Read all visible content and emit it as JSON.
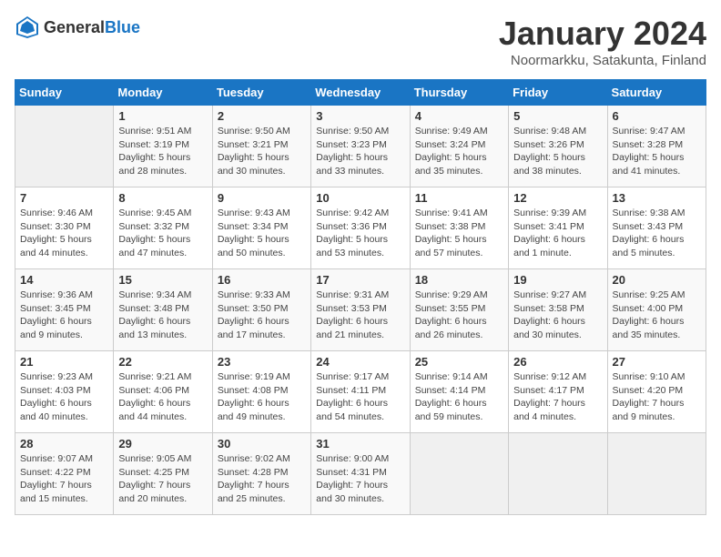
{
  "logo": {
    "text_general": "General",
    "text_blue": "Blue"
  },
  "title": "January 2024",
  "location": "Noormarkku, Satakunta, Finland",
  "days_of_week": [
    "Sunday",
    "Monday",
    "Tuesday",
    "Wednesday",
    "Thursday",
    "Friday",
    "Saturday"
  ],
  "weeks": [
    [
      {
        "day": "",
        "sunrise": "",
        "sunset": "",
        "daylight": ""
      },
      {
        "day": "1",
        "sunrise": "Sunrise: 9:51 AM",
        "sunset": "Sunset: 3:19 PM",
        "daylight": "Daylight: 5 hours and 28 minutes."
      },
      {
        "day": "2",
        "sunrise": "Sunrise: 9:50 AM",
        "sunset": "Sunset: 3:21 PM",
        "daylight": "Daylight: 5 hours and 30 minutes."
      },
      {
        "day": "3",
        "sunrise": "Sunrise: 9:50 AM",
        "sunset": "Sunset: 3:23 PM",
        "daylight": "Daylight: 5 hours and 33 minutes."
      },
      {
        "day": "4",
        "sunrise": "Sunrise: 9:49 AM",
        "sunset": "Sunset: 3:24 PM",
        "daylight": "Daylight: 5 hours and 35 minutes."
      },
      {
        "day": "5",
        "sunrise": "Sunrise: 9:48 AM",
        "sunset": "Sunset: 3:26 PM",
        "daylight": "Daylight: 5 hours and 38 minutes."
      },
      {
        "day": "6",
        "sunrise": "Sunrise: 9:47 AM",
        "sunset": "Sunset: 3:28 PM",
        "daylight": "Daylight: 5 hours and 41 minutes."
      }
    ],
    [
      {
        "day": "7",
        "sunrise": "Sunrise: 9:46 AM",
        "sunset": "Sunset: 3:30 PM",
        "daylight": "Daylight: 5 hours and 44 minutes."
      },
      {
        "day": "8",
        "sunrise": "Sunrise: 9:45 AM",
        "sunset": "Sunset: 3:32 PM",
        "daylight": "Daylight: 5 hours and 47 minutes."
      },
      {
        "day": "9",
        "sunrise": "Sunrise: 9:43 AM",
        "sunset": "Sunset: 3:34 PM",
        "daylight": "Daylight: 5 hours and 50 minutes."
      },
      {
        "day": "10",
        "sunrise": "Sunrise: 9:42 AM",
        "sunset": "Sunset: 3:36 PM",
        "daylight": "Daylight: 5 hours and 53 minutes."
      },
      {
        "day": "11",
        "sunrise": "Sunrise: 9:41 AM",
        "sunset": "Sunset: 3:38 PM",
        "daylight": "Daylight: 5 hours and 57 minutes."
      },
      {
        "day": "12",
        "sunrise": "Sunrise: 9:39 AM",
        "sunset": "Sunset: 3:41 PM",
        "daylight": "Daylight: 6 hours and 1 minute."
      },
      {
        "day": "13",
        "sunrise": "Sunrise: 9:38 AM",
        "sunset": "Sunset: 3:43 PM",
        "daylight": "Daylight: 6 hours and 5 minutes."
      }
    ],
    [
      {
        "day": "14",
        "sunrise": "Sunrise: 9:36 AM",
        "sunset": "Sunset: 3:45 PM",
        "daylight": "Daylight: 6 hours and 9 minutes."
      },
      {
        "day": "15",
        "sunrise": "Sunrise: 9:34 AM",
        "sunset": "Sunset: 3:48 PM",
        "daylight": "Daylight: 6 hours and 13 minutes."
      },
      {
        "day": "16",
        "sunrise": "Sunrise: 9:33 AM",
        "sunset": "Sunset: 3:50 PM",
        "daylight": "Daylight: 6 hours and 17 minutes."
      },
      {
        "day": "17",
        "sunrise": "Sunrise: 9:31 AM",
        "sunset": "Sunset: 3:53 PM",
        "daylight": "Daylight: 6 hours and 21 minutes."
      },
      {
        "day": "18",
        "sunrise": "Sunrise: 9:29 AM",
        "sunset": "Sunset: 3:55 PM",
        "daylight": "Daylight: 6 hours and 26 minutes."
      },
      {
        "day": "19",
        "sunrise": "Sunrise: 9:27 AM",
        "sunset": "Sunset: 3:58 PM",
        "daylight": "Daylight: 6 hours and 30 minutes."
      },
      {
        "day": "20",
        "sunrise": "Sunrise: 9:25 AM",
        "sunset": "Sunset: 4:00 PM",
        "daylight": "Daylight: 6 hours and 35 minutes."
      }
    ],
    [
      {
        "day": "21",
        "sunrise": "Sunrise: 9:23 AM",
        "sunset": "Sunset: 4:03 PM",
        "daylight": "Daylight: 6 hours and 40 minutes."
      },
      {
        "day": "22",
        "sunrise": "Sunrise: 9:21 AM",
        "sunset": "Sunset: 4:06 PM",
        "daylight": "Daylight: 6 hours and 44 minutes."
      },
      {
        "day": "23",
        "sunrise": "Sunrise: 9:19 AM",
        "sunset": "Sunset: 4:08 PM",
        "daylight": "Daylight: 6 hours and 49 minutes."
      },
      {
        "day": "24",
        "sunrise": "Sunrise: 9:17 AM",
        "sunset": "Sunset: 4:11 PM",
        "daylight": "Daylight: 6 hours and 54 minutes."
      },
      {
        "day": "25",
        "sunrise": "Sunrise: 9:14 AM",
        "sunset": "Sunset: 4:14 PM",
        "daylight": "Daylight: 6 hours and 59 minutes."
      },
      {
        "day": "26",
        "sunrise": "Sunrise: 9:12 AM",
        "sunset": "Sunset: 4:17 PM",
        "daylight": "Daylight: 7 hours and 4 minutes."
      },
      {
        "day": "27",
        "sunrise": "Sunrise: 9:10 AM",
        "sunset": "Sunset: 4:20 PM",
        "daylight": "Daylight: 7 hours and 9 minutes."
      }
    ],
    [
      {
        "day": "28",
        "sunrise": "Sunrise: 9:07 AM",
        "sunset": "Sunset: 4:22 PM",
        "daylight": "Daylight: 7 hours and 15 minutes."
      },
      {
        "day": "29",
        "sunrise": "Sunrise: 9:05 AM",
        "sunset": "Sunset: 4:25 PM",
        "daylight": "Daylight: 7 hours and 20 minutes."
      },
      {
        "day": "30",
        "sunrise": "Sunrise: 9:02 AM",
        "sunset": "Sunset: 4:28 PM",
        "daylight": "Daylight: 7 hours and 25 minutes."
      },
      {
        "day": "31",
        "sunrise": "Sunrise: 9:00 AM",
        "sunset": "Sunset: 4:31 PM",
        "daylight": "Daylight: 7 hours and 30 minutes."
      },
      {
        "day": "",
        "sunrise": "",
        "sunset": "",
        "daylight": ""
      },
      {
        "day": "",
        "sunrise": "",
        "sunset": "",
        "daylight": ""
      },
      {
        "day": "",
        "sunrise": "",
        "sunset": "",
        "daylight": ""
      }
    ]
  ]
}
